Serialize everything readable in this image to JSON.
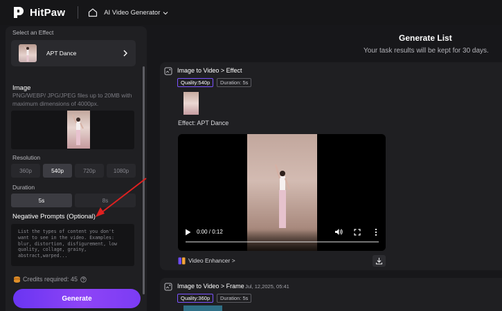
{
  "header": {
    "logo_text": "HitPaw",
    "breadcrumb": "AI Video Generator"
  },
  "left_panel": {
    "select_effect_label": "Select an Effect",
    "effect_name": "APT Dance",
    "image_label": "Image",
    "image_hint": "PNG/WEBP/ JPG/JPEG files up to 20MB with maximum dimensions of 4000px.",
    "resolution_label": "Resolution",
    "resolutions": [
      "360p",
      "540p",
      "720p",
      "1080p"
    ],
    "selected_resolution": "540p",
    "duration_label": "Duration",
    "durations": [
      "5s",
      "8s"
    ],
    "selected_duration": "5s",
    "negative_label": "Negative Prompts (Optional)",
    "negative_placeholder": "List the types of content you don't want to see in the video. Examples: blur, distortion, disfigurement, low quality, collage, grainy,  abstract,warped...",
    "credits_text": "Credits required: 45",
    "generate_label": "Generate"
  },
  "right_panel": {
    "title": "Generate List",
    "subtitle": "Your task results will be kept for 30 days.",
    "tasks": [
      {
        "title": "Image to Video > Effect",
        "date": "",
        "quality": "Quality:540p",
        "duration": "Duration: 5s",
        "effect_text": "Effect: APT Dance",
        "video_time": "0:00 / 0:12",
        "video_progress": 0,
        "enhancer_label": "Video Enhancer >"
      },
      {
        "title": "Image to Video > Frame",
        "date": "Jul, 12,2025, 05:41",
        "quality": "Quality:360p",
        "duration": "Duration: 5s"
      }
    ]
  },
  "colors": {
    "accent": "#7b53ff",
    "generate_gradient_start": "#6a35f2",
    "generate_gradient_end": "#8e44f6",
    "annotation_arrow": "#e02020"
  },
  "icons": [
    "logo-icon",
    "home-icon",
    "chevron-down-icon",
    "chevron-right-icon",
    "coin-icon",
    "help-icon",
    "task-type-icon",
    "play-icon",
    "volume-icon",
    "fullscreen-icon",
    "more-icon",
    "video-enhancer-icon",
    "download-icon"
  ]
}
